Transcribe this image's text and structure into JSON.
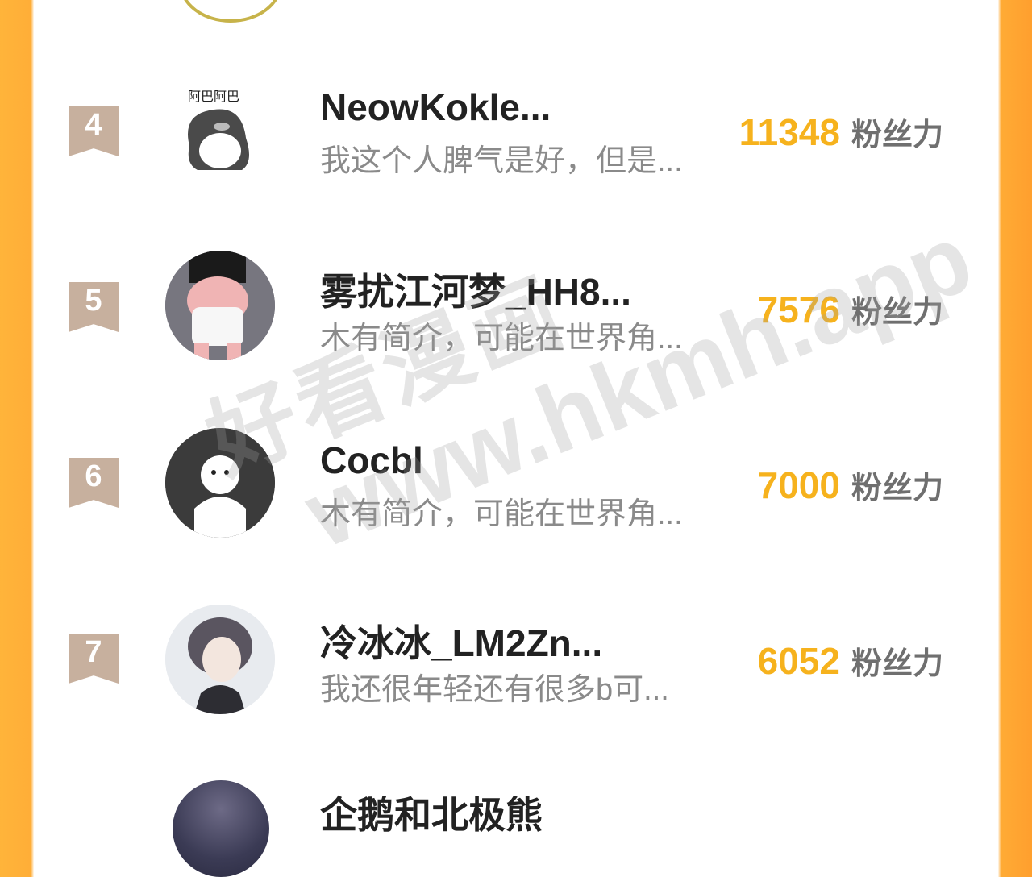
{
  "ranking": [
    {
      "rank": "4",
      "name": "NeowKokle...",
      "bio": "我这个人脾气是好，但是...",
      "fans": "11348",
      "unit": "粉丝力",
      "avatar": "penguin-sticker-avatar"
    },
    {
      "rank": "5",
      "name": "雾扰江河梦_HH8...",
      "bio": "木有简介，可能在世界角...",
      "fans": "7576",
      "unit": "粉丝力",
      "avatar": "baby-avatar"
    },
    {
      "rank": "6",
      "name": "Cocbl",
      "bio": "木有简介，可能在世界角...",
      "fans": "7000",
      "unit": "粉丝力",
      "avatar": "ghost-avatar"
    },
    {
      "rank": "7",
      "name": "冷冰冰_LM2Zn...",
      "bio": "我还很年轻还有很多b可...",
      "fans": "6052",
      "unit": "粉丝力",
      "avatar": "anime-girl-avatar"
    }
  ],
  "next_partial": {
    "name": "企鹅和北极熊"
  },
  "watermark": {
    "cn": "好看漫画",
    "url": "www.hkmh.app"
  },
  "colors": {
    "accent": "#f6b21d",
    "rank_badge": "#c7b09e",
    "frame": "#ffa935"
  }
}
